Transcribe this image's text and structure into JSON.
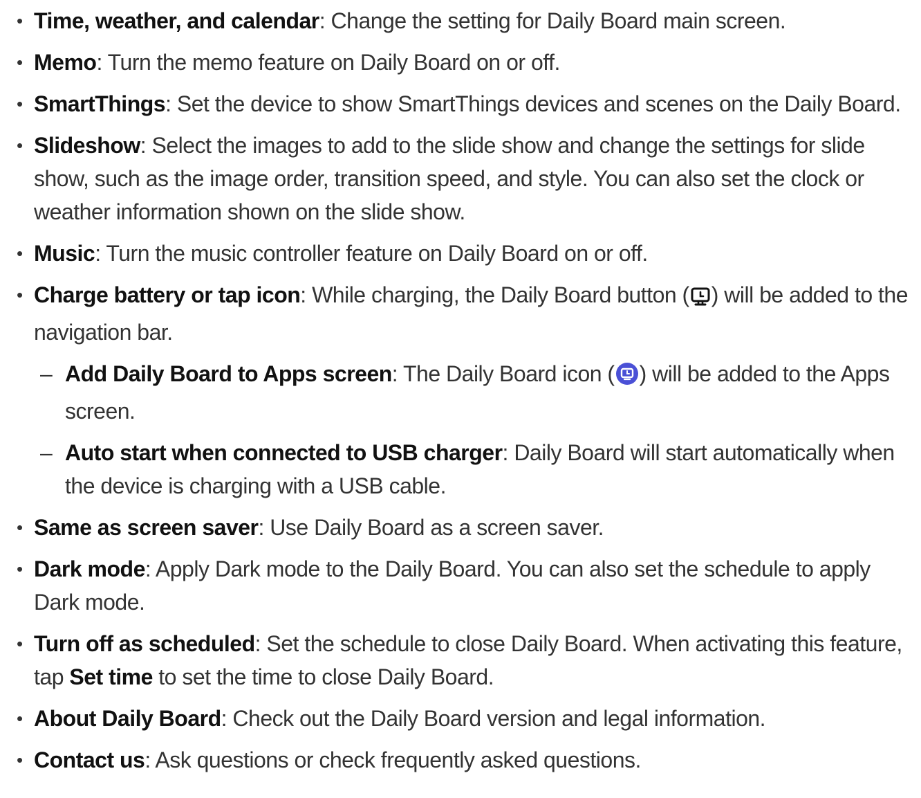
{
  "items": [
    {
      "term": "Time, weather, and calendar",
      "desc": ": Change the setting for Daily Board main screen."
    },
    {
      "term": "Memo",
      "desc": ": Turn the memo feature on Daily Board on or off."
    },
    {
      "term": "SmartThings",
      "desc": ": Set the device to show SmartThings devices and scenes on the Daily Board."
    },
    {
      "term": "Slideshow",
      "desc": ": Select the images to add to the slide show and change the settings for slide show, such as the image order, transition speed, and style. You can also set the clock or weather information shown on the slide show."
    },
    {
      "term": "Music",
      "desc": ": Turn the music controller feature on Daily Board on or off."
    },
    {
      "term": "Charge battery or tap icon",
      "desc_before": ": While charging, the Daily Board button (",
      "desc_after": ") will be added to the navigation bar.",
      "icon": "daily-board-button-icon"
    },
    {
      "term": "Add Daily Board to Apps screen",
      "desc_before": ": The Daily Board icon (",
      "desc_after": ") will be added to the Apps screen.",
      "icon": "daily-board-app-icon"
    },
    {
      "term": "Auto start when connected to USB charger",
      "desc": ": Daily Board will start automatically when the device is charging with a USB cable."
    },
    {
      "term": "Same as screen saver",
      "desc": ": Use Daily Board as a screen saver."
    },
    {
      "term": "Dark mode",
      "desc": ": Apply Dark mode to the Daily Board. You can also set the schedule to apply Dark mode."
    },
    {
      "term": "Turn off as scheduled",
      "desc_before": ": Set the schedule to close Daily Board. When activating this feature, tap ",
      "inline_bold": "Set time",
      "desc_after": " to set the time to close Daily Board."
    },
    {
      "term": "About Daily Board",
      "desc": ": Check out the Daily Board version and legal information."
    },
    {
      "term": "Contact us",
      "desc": ": Ask questions or check frequently asked questions."
    }
  ],
  "bullet": "•",
  "dash": "–",
  "colors": {
    "text": "#333333",
    "term": "#111111",
    "app_icon": "#4a50d6"
  }
}
